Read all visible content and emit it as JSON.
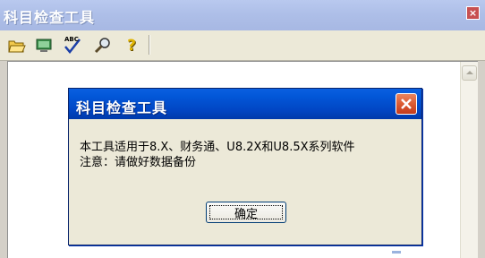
{
  "window": {
    "title": "科目检查工具",
    "close_glyph": "×"
  },
  "toolbar": {
    "buttons": [
      {
        "icon": "open-folder-icon"
      },
      {
        "icon": "computer-icon"
      },
      {
        "icon": "spell-check-icon",
        "text": "ABC"
      },
      {
        "icon": "search-magnifier-icon"
      },
      {
        "icon": "help-question-icon",
        "text": "?"
      }
    ]
  },
  "dialog": {
    "title": "科目检查工具",
    "message_line_1": "本工具适用于8.X、财务通、U8.2X和U8.5X系列软件",
    "message_line_2": "注意：请做好数据备份",
    "ok_label": "确定"
  },
  "colors": {
    "main_title_bar": "#aebfe8",
    "dialog_title_bar": "#0146c4",
    "dialog_close": "#dc5b33",
    "dialog_body": "#ece9d8"
  }
}
